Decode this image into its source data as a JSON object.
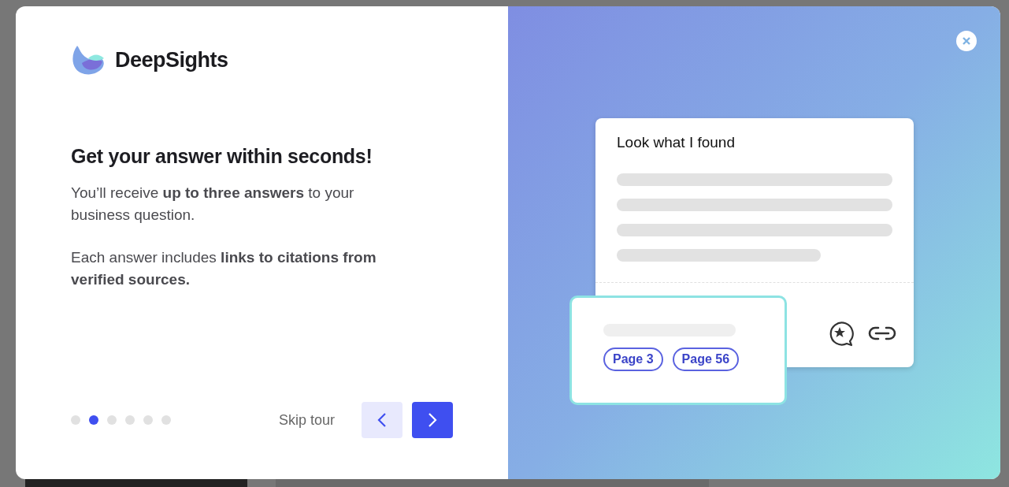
{
  "logo": {
    "name": "DeepSights"
  },
  "heading": "Get your answer within seconds!",
  "paragraphs": [
    "You’ll receive **up to three answers** to your business question.",
    "Each answer includes **links to citations from verified sources.**"
  ],
  "steps": [
    {
      "selected": false
    },
    {
      "selected": true
    },
    {
      "selected": false
    },
    {
      "selected": false
    },
    {
      "selected": false
    },
    {
      "selected": false
    }
  ],
  "skip_link": "Skip tour",
  "illustration": {
    "card_title": "Look what I found",
    "page_tags": [
      "Page 3",
      "Page 56"
    ]
  }
}
